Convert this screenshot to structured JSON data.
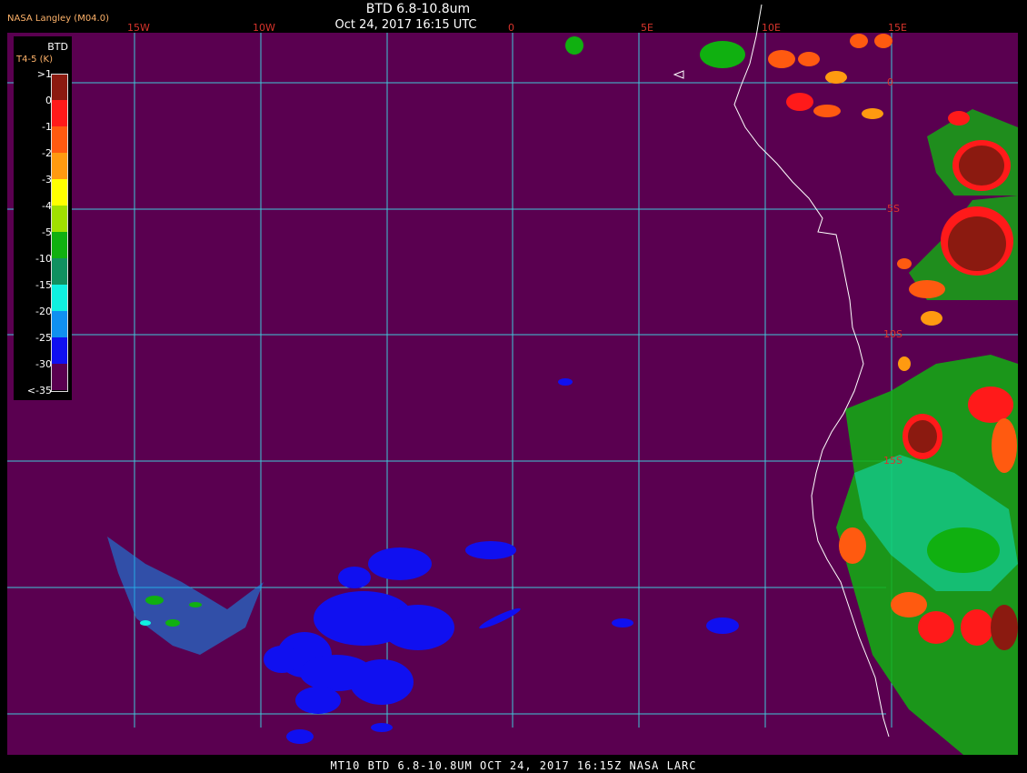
{
  "header": {
    "org_label": "NASA Langley (M04.0)",
    "title": "BTD 6.8-10.8um",
    "subtitle": "Oct 24, 2017 16:15 UTC"
  },
  "footer": {
    "text": "MT10  BTD 6.8-10.8UM  OCT 24, 2017 16:15Z  NASA LARC"
  },
  "grid": {
    "color": "#40c8d8",
    "lon_labels": [
      "15W",
      "10W",
      "0",
      "5E",
      "10E",
      "15E"
    ],
    "lat_labels": [
      "0",
      "5S",
      "10S",
      "15S"
    ]
  },
  "legend": {
    "title": "BTD",
    "units": "T4-5 (K)",
    "items": [
      {
        "label": ">1",
        "color": "#8b1a10"
      },
      {
        "label": "0",
        "color": "#ff1a1a"
      },
      {
        "label": "-1",
        "color": "#ff5a10"
      },
      {
        "label": "-2",
        "color": "#ff9a10"
      },
      {
        "label": "-3",
        "color": "#ffff00"
      },
      {
        "label": "-4",
        "color": "#a0e000"
      },
      {
        "label": "-5",
        "color": "#10b010"
      },
      {
        "label": "-10",
        "color": "#109060"
      },
      {
        "label": "-15",
        "color": "#10f0e0"
      },
      {
        "label": "-20",
        "color": "#1090f0"
      },
      {
        "label": "-25",
        "color": "#1010f0"
      },
      {
        "label": "-30",
        "color": "#5a0050"
      },
      {
        "label": "<-35",
        "color": "#5a0050"
      }
    ]
  },
  "colors": {
    "background": "#5a0050",
    "coastline": "#ffffff",
    "moisture_blue": "#1010f0",
    "cloud_green": "#10b010",
    "cloud_red": "#8b1a10"
  }
}
